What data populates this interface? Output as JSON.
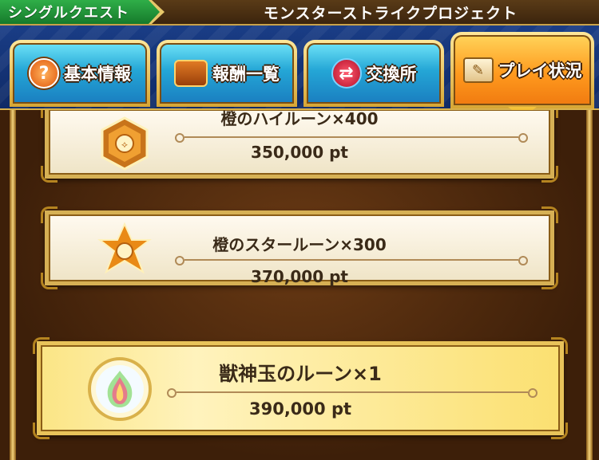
{
  "header": {
    "mode_label": "シングルクエスト",
    "event_title": "モンスターストライクプロジェクト"
  },
  "tabs": [
    {
      "label": "基本情報",
      "icon": "question-icon",
      "active": false
    },
    {
      "label": "報酬一覧",
      "icon": "treasure-chest-icon",
      "active": false
    },
    {
      "label": "交換所",
      "icon": "exchange-icon",
      "active": false
    },
    {
      "label": "プレイ状況",
      "icon": "scroll-icon",
      "active": true
    }
  ],
  "rewards": [
    {
      "name": "橙のハイルーン×400",
      "points": "350,000 pt",
      "icon": "orange-high-rune-icon",
      "highlight": false
    },
    {
      "name": "橙のスタールーン×300",
      "points": "370,000 pt",
      "icon": "orange-star-rune-icon",
      "highlight": false
    },
    {
      "name": "獣神玉のルーン×1",
      "points": "390,000 pt",
      "icon": "beast-god-orb-rune-icon",
      "highlight": true
    }
  ],
  "colors": {
    "tab_blue": "#24a6d6",
    "tab_orange": "#ff9a1e",
    "gold_frame": "#d6b054",
    "header_green": "#1f9a3a"
  }
}
